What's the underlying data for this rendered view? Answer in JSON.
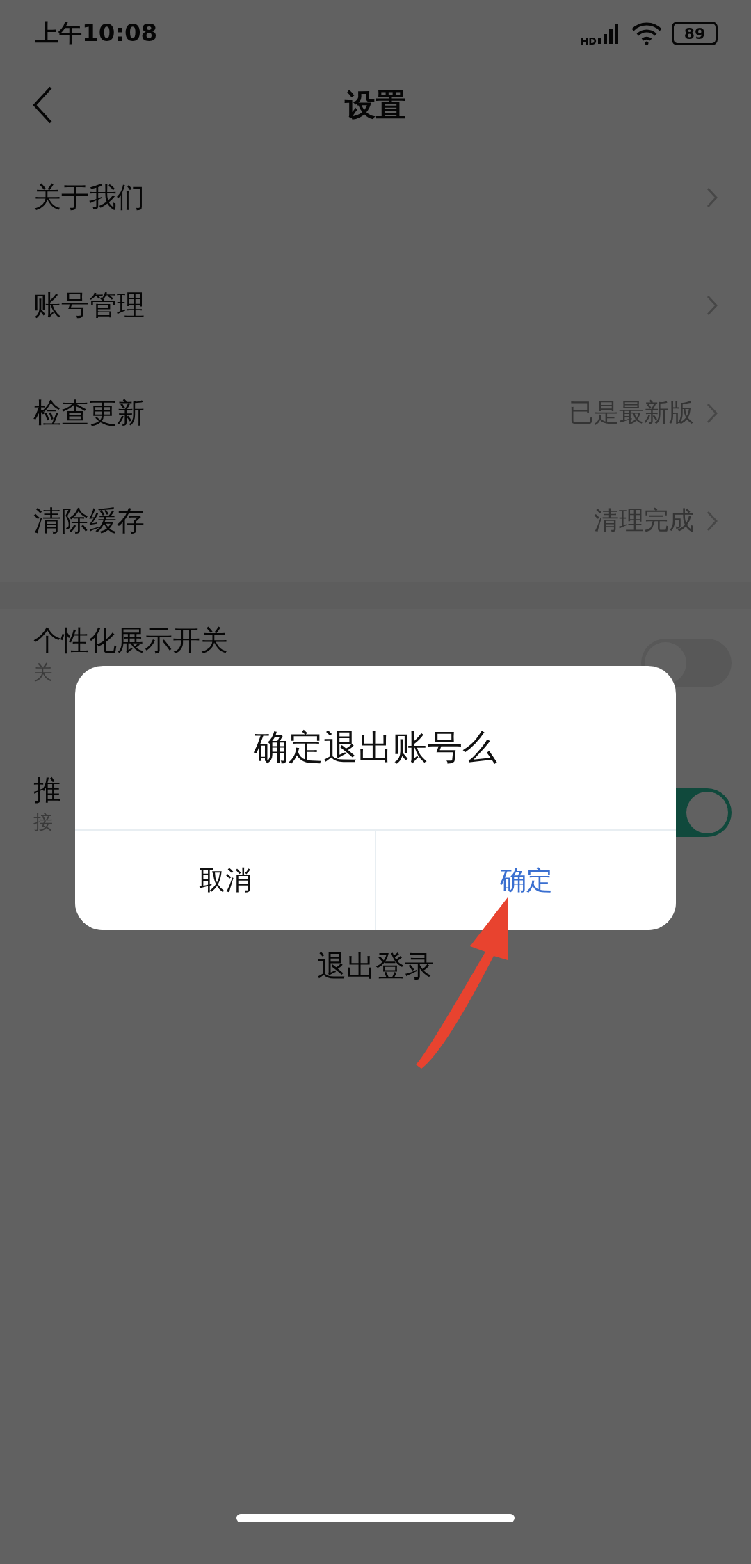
{
  "status_bar": {
    "time": "上午10:08",
    "network": "HD",
    "battery": "89"
  },
  "header": {
    "title": "设置"
  },
  "sections": [
    {
      "rows": [
        {
          "kind": "link",
          "label": "关于我们"
        },
        {
          "kind": "link",
          "label": "账号管理"
        },
        {
          "kind": "link",
          "label": "检查更新",
          "value": "已是最新版"
        },
        {
          "kind": "link",
          "label": "清除缓存",
          "value": "清理完成"
        }
      ]
    },
    {
      "rows": [
        {
          "kind": "switch",
          "label": "个性化展示开关",
          "subtitle": "关",
          "on": false
        },
        {
          "kind": "switch",
          "label": "推",
          "subtitle": "接",
          "on": true
        }
      ]
    }
  ],
  "logout": "退出登录",
  "dialog": {
    "title": "确定退出账号么",
    "buttons": [
      {
        "kind": "cancel",
        "label": "取消"
      },
      {
        "kind": "confirm",
        "label": "确定"
      }
    ]
  }
}
